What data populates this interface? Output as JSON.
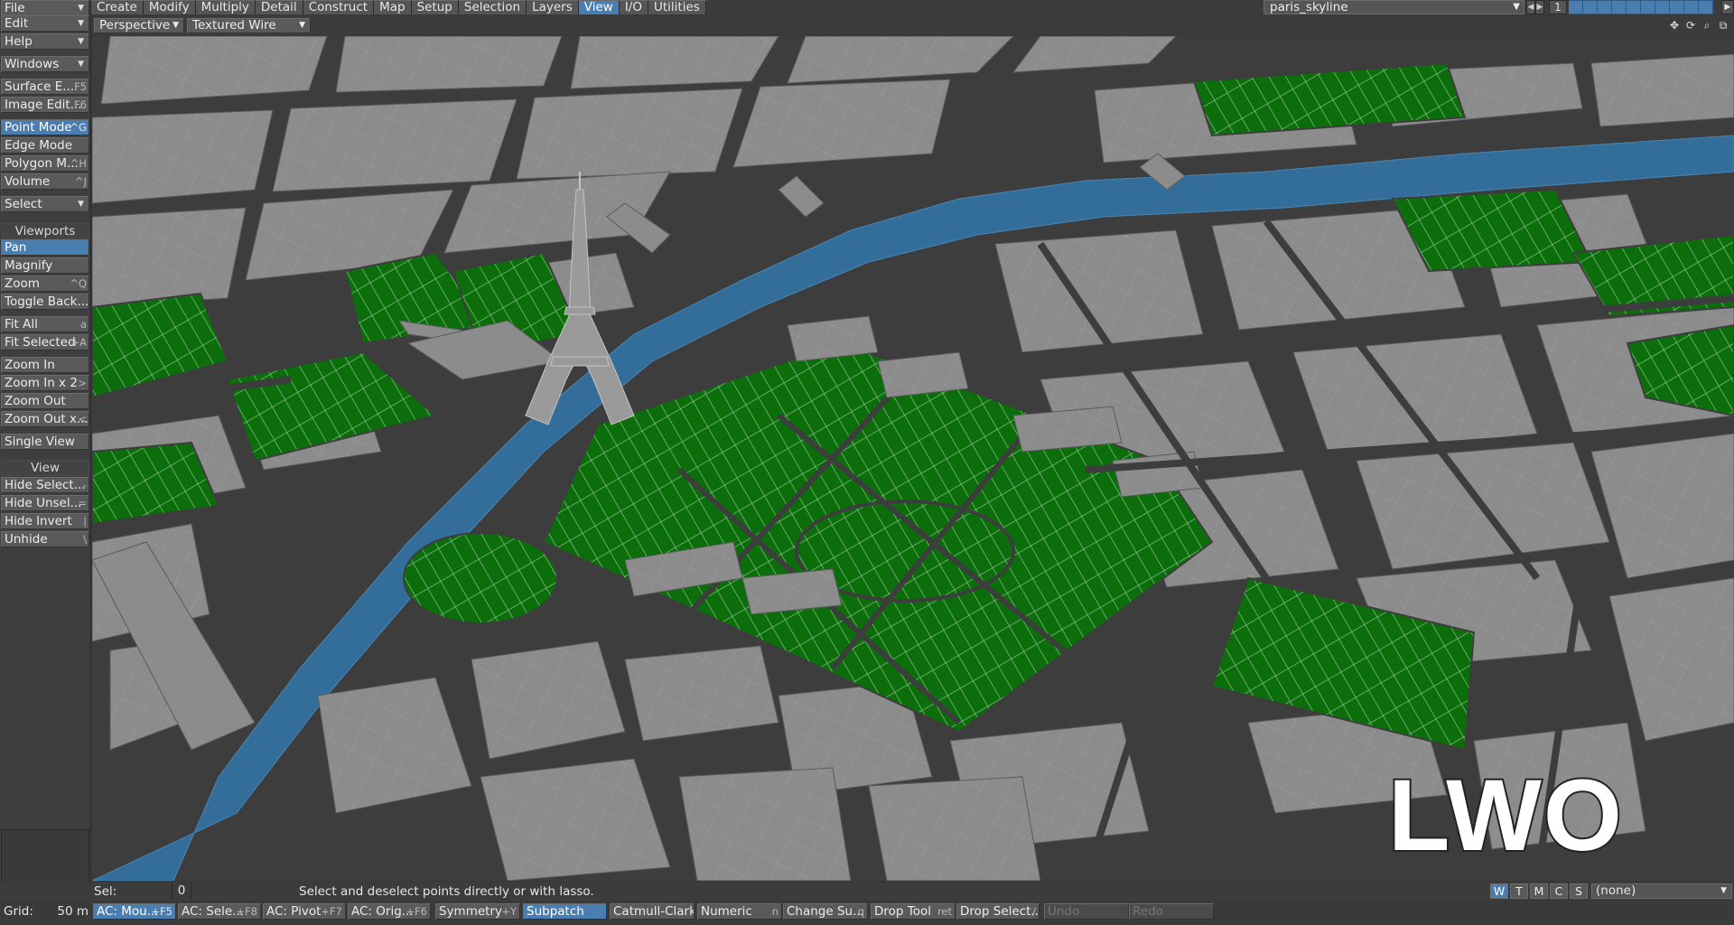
{
  "top_tabs": [
    "Create",
    "Modify",
    "Multiply",
    "Detail",
    "Construct",
    "Map",
    "Setup",
    "Selection",
    "Layers",
    "View",
    "I/O",
    "Utilities"
  ],
  "active_tab": "View",
  "scene_name": "paris_skyline",
  "layer_number": "1",
  "sidebar": {
    "file": "File",
    "edit": "Edit",
    "help": "Help",
    "windows": "Windows",
    "surface_editor": "Surface E...",
    "surface_editor_sc": "F5",
    "image_editor": "Image Edit...",
    "image_editor_sc": "F6",
    "point_mode": "Point Mode",
    "point_mode_sc": "^G",
    "edge_mode": "Edge Mode",
    "polygon_mode": "Polygon M...",
    "polygon_mode_sc": "^H",
    "volume": "Volume",
    "volume_sc": "^J",
    "select": "Select",
    "viewports_header": "Viewports",
    "pan": "Pan",
    "magnify": "Magnify",
    "zoom": "Zoom",
    "zoom_sc": "^Q",
    "toggle_back": "Toggle Back...",
    "fit_all": "Fit All",
    "fit_all_sc": "a",
    "fit_selected": "Fit Selected",
    "fit_selected_sc": "+A",
    "zoom_in": "Zoom In",
    "zoom_in_x2": "Zoom In x 2",
    "zoom_in_x2_sc": ">",
    "zoom_out": "Zoom Out",
    "zoom_out_x": "Zoom Out x...",
    "zoom_out_x_sc": "<",
    "single_view": "Single View",
    "view_header": "View",
    "hide_selected": "Hide Select...",
    "hide_selected_sc": "-",
    "hide_unselected": "Hide Unsel...",
    "hide_unselected_sc": "=",
    "hide_invert": "Hide Invert",
    "hide_invert_sc": "|",
    "unhide": "Unhide",
    "unhide_sc": "\\"
  },
  "viewport": {
    "view_type": "Perspective",
    "render_mode": "Textured Wire",
    "badge": "LWO"
  },
  "status": {
    "sel_label": "Sel:",
    "sel_value": "0",
    "message": "Select and deselect points directly or with lasso.",
    "wtmcs": [
      "W",
      "T",
      "M",
      "C",
      "S"
    ],
    "surface": "(none)"
  },
  "bottom": {
    "grid_label": "Grid:",
    "grid_value": "50 m",
    "ac_mouse": "AC: Mou...",
    "ac_mouse_sc": "+F5",
    "ac_selection": "AC: Sele...",
    "ac_selection_sc": "+F8",
    "ac_pivot": "AC: Pivot",
    "ac_pivot_sc": "+F7",
    "ac_origin": "AC: Orig...",
    "ac_origin_sc": "+F6",
    "symmetry": "Symmetry",
    "symmetry_sc": "+Y",
    "subpatch": "Subpatch",
    "catmull": "Catmull-Clark",
    "numeric": "Numeric",
    "numeric_sc": "n",
    "change_surface": "Change Su...",
    "change_surface_sc": "q",
    "drop_tool": "Drop Tool",
    "drop_tool_sc": "ret",
    "drop_selection": "Drop Select...",
    "drop_selection_sc": "/",
    "undo": "Undo",
    "redo": "Redo"
  },
  "colors": {
    "accent": "#4a7eb0",
    "building": "#8c8c8c",
    "park": "#0b6e0b",
    "river": "#336e9a",
    "road": "#3d3d3d"
  }
}
